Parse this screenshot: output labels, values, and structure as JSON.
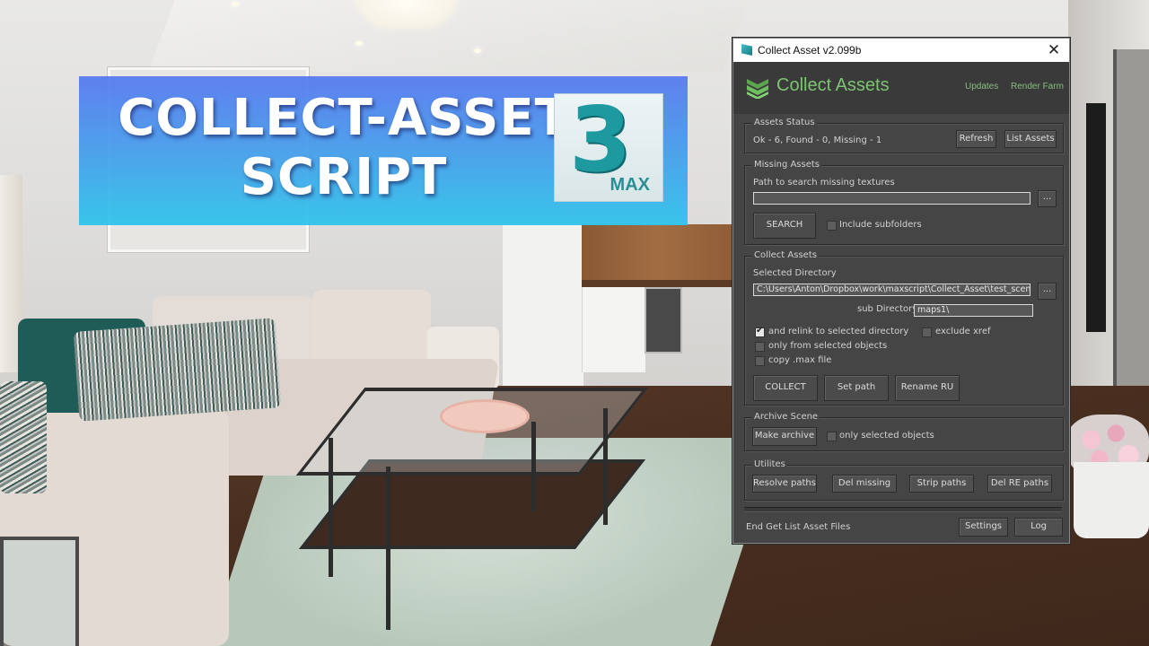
{
  "banner": {
    "title_line1": "COLLECT-ASSET",
    "title_line2": "SCRIPT",
    "logo_number": "3",
    "logo_text": "MAX"
  },
  "window": {
    "title": "Collect Asset v2.099b",
    "close_icon": "close-icon",
    "app_icon": "3dsmax-icon"
  },
  "header": {
    "logo_text": "Collect Assets",
    "logo_icon": "chevron-stack-icon",
    "links": [
      "Updates",
      "Render Farm"
    ],
    "accent_color": "#7dc472"
  },
  "assets_status": {
    "label": "Assets Status",
    "status_text": "Ok - 6, Found - 0, Missing - 1",
    "refresh_label": "Refresh",
    "list_assets_label": "List Assets"
  },
  "missing_assets": {
    "label": "Missing Assets",
    "path_label": "Path to search missing textures",
    "path_value": "",
    "browse_label": "...",
    "search_label": "SEARCH",
    "include_subfolders_label": "Include subfolders",
    "include_subfolders_checked": false
  },
  "collect_assets": {
    "label": "Collect Assets",
    "selected_dir_label": "Selected Directory",
    "selected_dir_value": "C:\\Users\\Anton\\Dropbox\\work\\maxscript\\Collect_Asset\\test_scenes\\",
    "browse_label": "...",
    "sub_dir_label": "sub Directory",
    "sub_dir_value": "maps1\\",
    "options": [
      {
        "label": "and relink to selected directory",
        "checked": true
      },
      {
        "label": "only from selected objects",
        "checked": false
      },
      {
        "label": "copy .max file",
        "checked": false
      },
      {
        "label": "exclude xref",
        "checked": false
      }
    ],
    "collect_label": "COLLECT",
    "set_path_label": "Set path",
    "rename_label": "Rename RU"
  },
  "archive_scene": {
    "label": "Archive Scene",
    "make_archive_label": "Make archive",
    "only_selected_label": "only selected objects",
    "only_selected_checked": false
  },
  "utilities": {
    "label": "Utilites",
    "buttons": [
      "Resolve paths",
      "Del missing",
      "Strip paths",
      "Del RE paths"
    ]
  },
  "footer": {
    "status_text": "End Get List Asset Files",
    "settings_label": "Settings",
    "log_label": "Log"
  }
}
